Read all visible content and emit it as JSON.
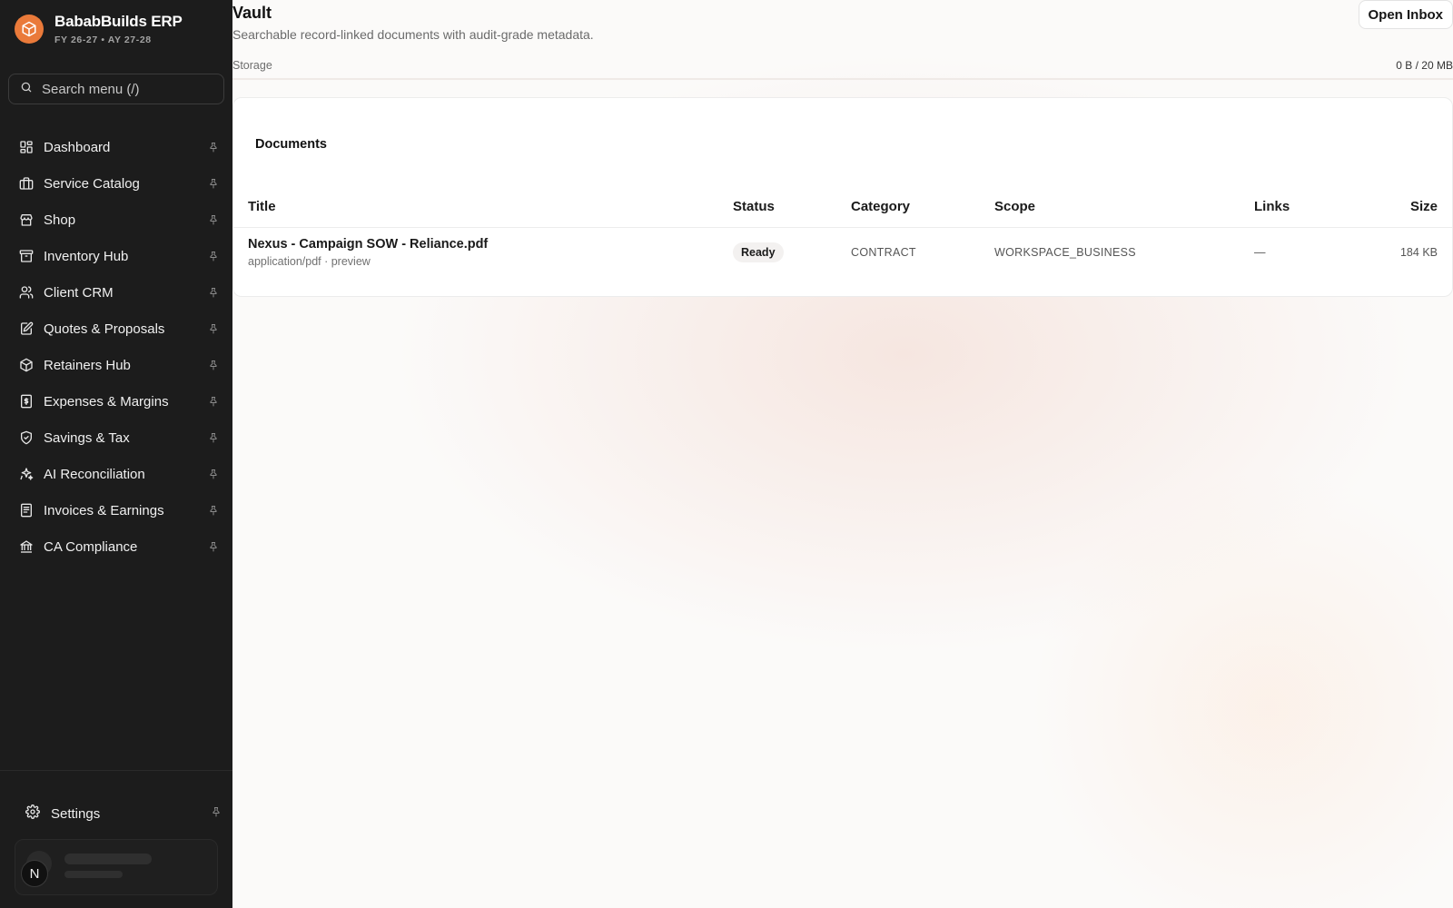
{
  "app": {
    "name": "BababBuilds ERP",
    "period": "FY 26-27 • AY 27-28"
  },
  "search": {
    "placeholder": "Search menu (/)"
  },
  "sidebar": {
    "items": [
      {
        "label": "Dashboard",
        "icon": "dashboard-icon"
      },
      {
        "label": "Service Catalog",
        "icon": "briefcase-icon"
      },
      {
        "label": "Shop",
        "icon": "store-icon"
      },
      {
        "label": "Inventory Hub",
        "icon": "archive-icon"
      },
      {
        "label": "Client CRM",
        "icon": "users-icon"
      },
      {
        "label": "Quotes & Proposals",
        "icon": "edit-document-icon"
      },
      {
        "label": "Retainers Hub",
        "icon": "box-icon"
      },
      {
        "label": "Expenses & Margins",
        "icon": "receipt-dollar-icon"
      },
      {
        "label": "Savings & Tax",
        "icon": "shield-dollar-icon"
      },
      {
        "label": "AI Reconciliation",
        "icon": "sparkles-icon"
      },
      {
        "label": "Invoices & Earnings",
        "icon": "invoice-icon"
      },
      {
        "label": "CA Compliance",
        "icon": "bank-icon"
      }
    ],
    "settings_label": "Settings",
    "user_initial": "N"
  },
  "page": {
    "title": "Vault",
    "subtitle": "Searchable record-linked documents with audit-grade metadata.",
    "open_inbox_label": "Open Inbox",
    "storage_label": "Storage",
    "storage_value": "0 B / 20 MB",
    "storage_used_fraction": 0
  },
  "documents": {
    "title": "Documents",
    "columns": {
      "title": "Title",
      "status": "Status",
      "category": "Category",
      "scope": "Scope",
      "links": "Links",
      "size": "Size"
    },
    "rows": [
      {
        "name": "Nexus - Campaign SOW - Reliance.pdf",
        "meta": "application/pdf · preview",
        "status": "Ready",
        "category": "CONTRACT",
        "scope": "WORKSPACE_BUSINESS",
        "links": "—",
        "size": "184 KB"
      }
    ]
  },
  "colors": {
    "accent": "#ea7a3a",
    "sidebar_bg": "#1c1c1c"
  }
}
